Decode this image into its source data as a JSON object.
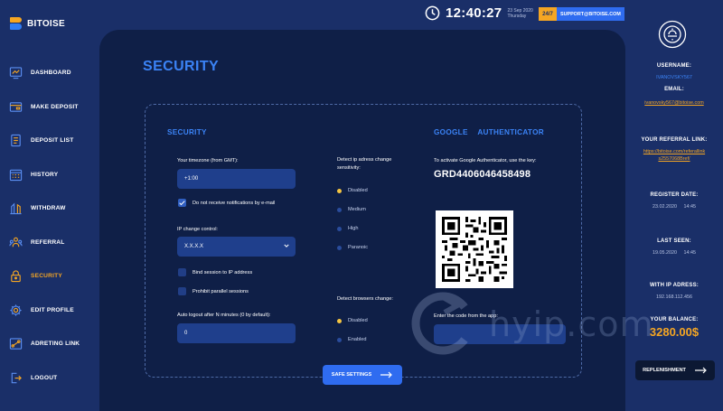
{
  "brand": {
    "name": "BITOISE"
  },
  "clock": {
    "time": "12:40:27",
    "date": "23 Sep 2020",
    "weekday": "Thursday"
  },
  "support": {
    "badge": "24/7",
    "email": "SUPPORT@BITOISE.COM"
  },
  "sidebar": {
    "items": [
      {
        "label": "DASHBOARD",
        "icon": "dashboard-icon"
      },
      {
        "label": "MAKE DEPOSIT",
        "icon": "make-deposit-icon"
      },
      {
        "label": "DEPOSIT LIST",
        "icon": "deposit-list-icon"
      },
      {
        "label": "HISTORY",
        "icon": "history-icon"
      },
      {
        "label": "WITHDRAW",
        "icon": "withdraw-icon"
      },
      {
        "label": "REFERRAL",
        "icon": "referral-icon"
      },
      {
        "label": "SECURITY",
        "icon": "lock-icon",
        "active": true
      },
      {
        "label": "EDIT PROFILE",
        "icon": "gear-icon"
      },
      {
        "label": "ADRETING LINK",
        "icon": "link-icon"
      },
      {
        "label": "LOGOUT",
        "icon": "logout-icon"
      }
    ]
  },
  "page": {
    "title": "SECURITY"
  },
  "security": {
    "heading": "SECURITY",
    "timezone_label": "Your timezone (from GMT):",
    "timezone_value": "+1:00",
    "no_email_label": "Do not receive notifications by e-mail",
    "no_email_checked": true,
    "ip_control_label": "IP change control:",
    "ip_control_value": "X.X.X.X",
    "bind_session_label": "Bind session to IP address",
    "bind_session_checked": false,
    "prohibit_parallel_label": "Prohibit parallel sessions",
    "prohibit_parallel_checked": false,
    "auto_logout_label": "Auto logout after N minutes (0 by default):",
    "auto_logout_value": "0"
  },
  "ip_sensitivity": {
    "label_line1": "Detect ip adress change",
    "label_line2": "sensitivity:",
    "options": [
      "Disabled",
      "Medium",
      "High",
      "Paranoic"
    ],
    "selected": "Disabled"
  },
  "browser_change": {
    "label": "Detect browsers change:",
    "options": [
      "Disabled",
      "Enabled"
    ],
    "selected": "Disabled"
  },
  "google_auth": {
    "heading_part1": "GOOGLE",
    "heading_part2": "AUTHENTICATOR",
    "instruction": "To activate Google Authenticator, use the key:",
    "key": "GRD4406046458498",
    "code_label": "Enter the code from the app:",
    "code_value": ""
  },
  "actions": {
    "save_label": "SAFE SETTINGS",
    "replenish_label": "REPLENISHMENT"
  },
  "account": {
    "username_label": "USERNAME:",
    "username": "IVANOVSKY567",
    "email_label": "EMAIL:",
    "email": "ivanovsky567@bitoise.com",
    "referral_label": "YOUR REFERRAL LINK:",
    "referral_line1": "https://bitoise.com/referallink",
    "referral_line2": "s2557068Bref/",
    "register_label": "REGISTER DATE:",
    "register_date": "23.02.2020",
    "register_time": "14:45",
    "last_seen_label": "LAST SEEN:",
    "last_seen_date": "19.05.2020",
    "last_seen_time": "14:45",
    "ip_label": "WITH IP ADRESS:",
    "ip": "192.168.112.456",
    "balance_label": "YOUR BALANCE:",
    "balance": "3280.00$"
  },
  "watermark": {
    "text": "hyip.com"
  },
  "colors": {
    "accent": "#3b83f6",
    "highlight": "#f5a623",
    "background": "#1a2f68",
    "panel": "#0f1f47",
    "field": "#1f3f8c"
  }
}
